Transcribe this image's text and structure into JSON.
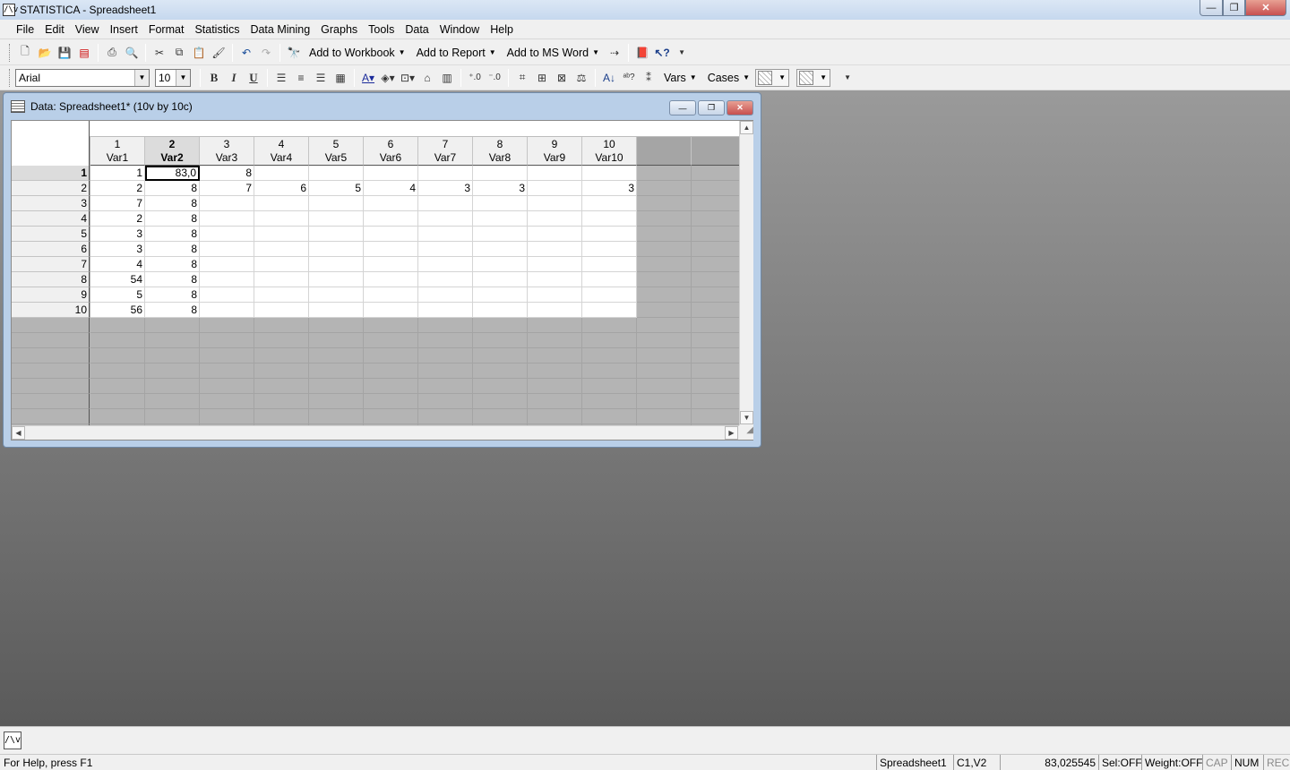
{
  "window": {
    "title": "STATISTICA - Spreadsheet1",
    "min_glyph": "—",
    "max_glyph": "❐",
    "close_glyph": "✕",
    "icon_glyph": "/\\v"
  },
  "menu": [
    "File",
    "Edit",
    "View",
    "Insert",
    "Format",
    "Statistics",
    "Data Mining",
    "Graphs",
    "Tools",
    "Data",
    "Window",
    "Help"
  ],
  "toolbar1": {
    "add_to_workbook": "Add to Workbook",
    "add_to_report": "Add to Report",
    "add_to_msword": "Add to MS Word"
  },
  "toolbar2": {
    "font": "Arial",
    "font_size": "10",
    "vars": "Vars",
    "cases": "Cases"
  },
  "spreadsheet": {
    "title": "Data: Spreadsheet1* (10v by 10c)",
    "columns": [
      {
        "num": "1",
        "name": "Var1"
      },
      {
        "num": "2",
        "name": "Var2"
      },
      {
        "num": "3",
        "name": "Var3"
      },
      {
        "num": "4",
        "name": "Var4"
      },
      {
        "num": "5",
        "name": "Var5"
      },
      {
        "num": "6",
        "name": "Var6"
      },
      {
        "num": "7",
        "name": "Var7"
      },
      {
        "num": "8",
        "name": "Var8"
      },
      {
        "num": "9",
        "name": "Var9"
      },
      {
        "num": "10",
        "name": "Var10"
      }
    ],
    "row_labels": [
      "1",
      "2",
      "3",
      "4",
      "5",
      "6",
      "7",
      "8",
      "9",
      "10"
    ],
    "rows": [
      [
        "1",
        "83,0",
        "8",
        "",
        "",
        "",
        "",
        "",
        "",
        ""
      ],
      [
        "2",
        "8",
        "7",
        "6",
        "5",
        "4",
        "3",
        "3",
        "",
        "3"
      ],
      [
        "7",
        "8",
        "",
        "",
        "",
        "",
        "",
        "",
        "",
        ""
      ],
      [
        "2",
        "8",
        "",
        "",
        "",
        "",
        "",
        "",
        "",
        ""
      ],
      [
        "3",
        "8",
        "",
        "",
        "",
        "",
        "",
        "",
        "",
        ""
      ],
      [
        "3",
        "8",
        "",
        "",
        "",
        "",
        "",
        "",
        "",
        ""
      ],
      [
        "4",
        "8",
        "",
        "",
        "",
        "",
        "",
        "",
        "",
        ""
      ],
      [
        "54",
        "8",
        "",
        "",
        "",
        "",
        "",
        "",
        "",
        ""
      ],
      [
        "5",
        "8",
        "",
        "",
        "",
        "",
        "",
        "",
        "",
        ""
      ],
      [
        "56",
        "8",
        "",
        "",
        "",
        "",
        "",
        "",
        "",
        ""
      ]
    ],
    "active_row": 0,
    "active_col": 1
  },
  "statusbar": {
    "help": "For Help, press F1",
    "sheet": "Spreadsheet1",
    "cell": "C1,V2",
    "value": "83,025545",
    "sel": "Sel:OFF",
    "weight": "Weight:OFF",
    "cap": "CAP",
    "num": "NUM",
    "rec": "REC"
  }
}
